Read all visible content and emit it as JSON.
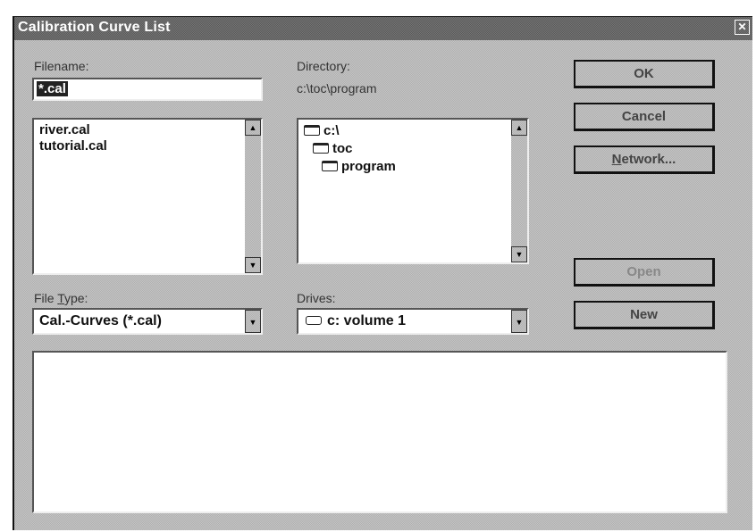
{
  "window": {
    "title": "Calibration Curve List",
    "close_glyph": "✕"
  },
  "filename": {
    "label": "Filename:",
    "value": "*.cal",
    "files": [
      "river.cal",
      "tutorial.cal"
    ]
  },
  "directory": {
    "label": "Directory:",
    "path": "c:\\toc\\program",
    "folders": [
      "c:\\",
      "toc",
      "program"
    ]
  },
  "file_type": {
    "label_pre": "File ",
    "label_underlined": "T",
    "label_post": "ype:",
    "selected": "Cal.-Curves (*.cal)"
  },
  "drives": {
    "label": "Drives:",
    "selected": "c: volume 1"
  },
  "buttons": {
    "ok": "OK",
    "cancel": "Cancel",
    "network_underlined": "N",
    "network_rest": "etwork...",
    "open": "Open",
    "new": "New"
  },
  "icons": {
    "folder": "folder-open-icon",
    "drive": "hard-drive-icon",
    "arrow_up": "▲",
    "arrow_down": "▼"
  }
}
